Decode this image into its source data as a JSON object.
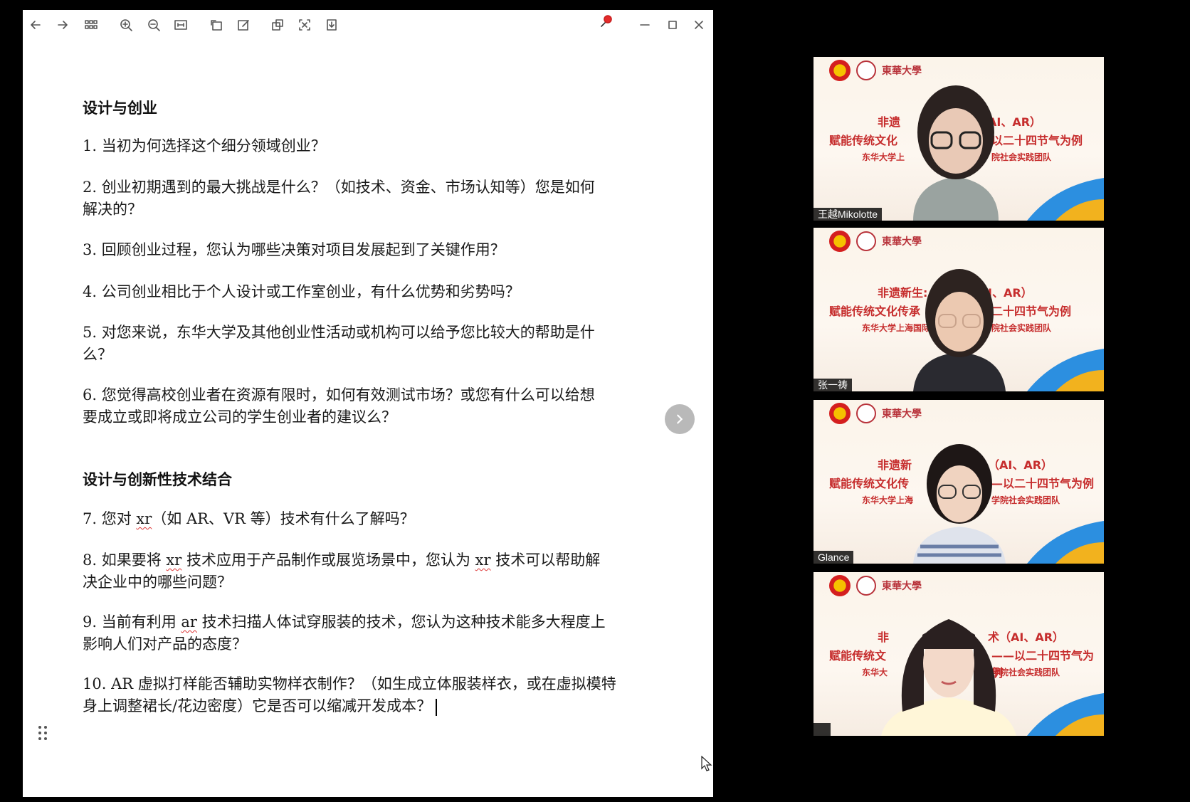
{
  "toolbar": {
    "buttons": [
      "back-icon",
      "forward-icon",
      "grid-view-icon",
      "zoom-in-icon",
      "zoom-out-icon",
      "fit-width-icon",
      "rotate-icon",
      "edit-icon",
      "copy-icon",
      "screenshot-icon",
      "download-icon"
    ],
    "window_controls": [
      "minimize-icon",
      "maximize-icon",
      "close-icon"
    ]
  },
  "document": {
    "section1_title": "设计与创业",
    "q1": "1. 当初为何选择这个细分领域创业？",
    "q2_line1": "2. 创业初期遇到的最大挑战是什么？（如技术、资金、市场认知等）您是如何",
    "q2_line2": "解决的？",
    "q3": "3. 回顾创业过程，您认为哪些决策对项目发展起到了关键作用？",
    "q4": "4. 公司创业相比于个人设计或工作室创业，有什么优势和劣势吗？",
    "q5_line1": "5. 对您来说，东华大学及其他创业性活动或机构可以给予您比较大的帮助是什",
    "q5_line2": "么？",
    "q6_line1": "6. 您觉得高校创业者在资源有限时，如何有效测试市场？或您有什么可以给想",
    "q6_line2": "要成立或即将成立公司的学生创业者的建议么？",
    "section2_title": "设计与创新性技术结合",
    "q7_pre": "7. 您对 ",
    "q7_xr": "xr",
    "q7_post": "（如 AR、VR 等）技术有什么了解吗？",
    "q8_pre": "8. 如果要将 ",
    "q8_xr1": "xr",
    "q8_mid": " 技术应用于产品制作或展览场景中，您认为 ",
    "q8_xr2": "xr",
    "q8_post": " 技术可以帮助解",
    "q8_line2": "决企业中的哪些问题？",
    "q9_pre": "9. 当前有利用 ",
    "q9_ar": "ar",
    "q9_post": " 技术扫描人体试穿服装的技术，您认为这种技术能多大程度上",
    "q9_line2": "影响人们对产品的态度？",
    "q10_line1": "10. AR 虚拟打样能否辅助实物样衣制作？（如生成立体服装样衣，或在虚拟模特",
    "q10_line2": "身上调整裙长/花边密度）它是否可以缩减开发成本？"
  },
  "participants": [
    {
      "name": "王越Mikolotte",
      "banner_l1a": "非遗",
      "banner_l1b": "AI、AR）",
      "banner_l2a": "赋能传统文化",
      "banner_l2b": "以二十四节气为例",
      "banner_l3a": "东华大学上",
      "banner_l3b": "院社会实践团队",
      "university": "東華大學"
    },
    {
      "name": "张一祷",
      "banner_l1a": "非遗新生:",
      "banner_l1b": "I、AR）",
      "banner_l2a": "赋能传统文化传承",
      "banner_l2b": "二十四节气为例",
      "banner_l3a": "东华大学上海国际",
      "banner_l3b": "院社会实践团队",
      "university": "東華大學"
    },
    {
      "name": "Glance",
      "banner_l1a": "非遗新",
      "banner_l1b": "（AI、AR）",
      "banner_l2a": "赋能传统文化传",
      "banner_l2b": "—以二十四节气为例",
      "banner_l3a": "东华大学上海",
      "banner_l3b": "学院社会实践团队",
      "university": "東華大學"
    },
    {
      "name": "",
      "banner_l1a": "非",
      "banner_l1b": "术（AI、AR）",
      "banner_l2a": "赋能传统文",
      "banner_l2b": "——以二十四节气为例",
      "banner_l3a": "东华大",
      "banner_l3b": "学院社会实践团队",
      "university": "東華大學"
    }
  ],
  "colors": {
    "banner_red": "#c62d2d",
    "doc_bg": "#ffffff",
    "screen_bg": "#000000",
    "spellcheck": "#dd3333"
  }
}
